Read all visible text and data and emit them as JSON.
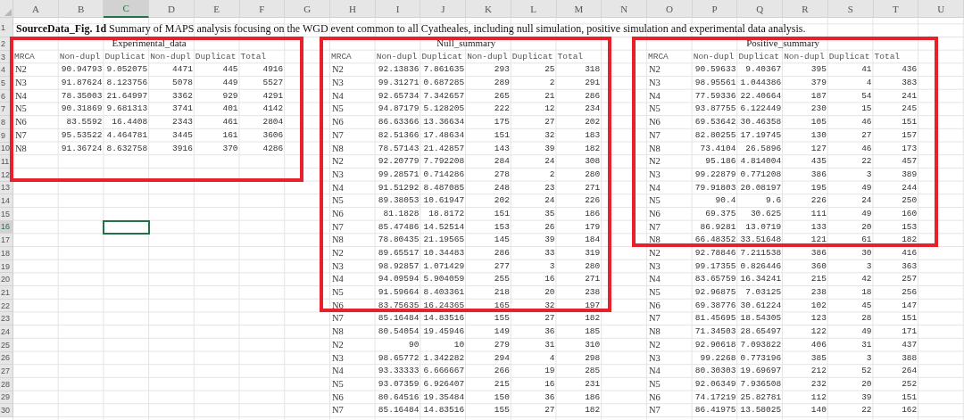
{
  "column_headers": [
    {
      "label": "A",
      "selected": false
    },
    {
      "label": "B",
      "selected": false
    },
    {
      "label": "C",
      "selected": true
    },
    {
      "label": "D",
      "selected": false
    },
    {
      "label": "E",
      "selected": false
    },
    {
      "label": "F",
      "selected": false
    },
    {
      "label": "G",
      "selected": false
    },
    {
      "label": "H",
      "selected": false
    },
    {
      "label": "I",
      "selected": false
    },
    {
      "label": "J",
      "selected": false
    },
    {
      "label": "K",
      "selected": false
    },
    {
      "label": "L",
      "selected": false
    },
    {
      "label": "M",
      "selected": false
    },
    {
      "label": "N",
      "selected": false
    },
    {
      "label": "O",
      "selected": false
    },
    {
      "label": "P",
      "selected": false
    },
    {
      "label": "Q",
      "selected": false
    },
    {
      "label": "R",
      "selected": false
    },
    {
      "label": "S",
      "selected": false
    },
    {
      "label": "T",
      "selected": false
    },
    {
      "label": "U",
      "selected": false
    }
  ],
  "row_headers": [
    {
      "label": "1",
      "selected": false
    },
    {
      "label": "2",
      "selected": false
    },
    {
      "label": "3",
      "selected": false
    },
    {
      "label": "4",
      "selected": false
    },
    {
      "label": "5",
      "selected": false
    },
    {
      "label": "6",
      "selected": false
    },
    {
      "label": "7",
      "selected": false
    },
    {
      "label": "8",
      "selected": false
    },
    {
      "label": "9",
      "selected": false
    },
    {
      "label": "10",
      "selected": false
    },
    {
      "label": "11",
      "selected": false
    },
    {
      "label": "12",
      "selected": false
    },
    {
      "label": "13",
      "selected": false
    },
    {
      "label": "14",
      "selected": false
    },
    {
      "label": "15",
      "selected": false
    },
    {
      "label": "16",
      "selected": true
    },
    {
      "label": "17",
      "selected": false
    },
    {
      "label": "18",
      "selected": false
    },
    {
      "label": "19",
      "selected": false
    },
    {
      "label": "20",
      "selected": false
    },
    {
      "label": "21",
      "selected": false
    },
    {
      "label": "22",
      "selected": false
    },
    {
      "label": "23",
      "selected": false
    },
    {
      "label": "24",
      "selected": false
    },
    {
      "label": "25",
      "selected": false
    },
    {
      "label": "26",
      "selected": false
    },
    {
      "label": "27",
      "selected": false
    },
    {
      "label": "28",
      "selected": false
    },
    {
      "label": "29",
      "selected": false
    },
    {
      "label": "30",
      "selected": false
    }
  ],
  "title": "**SourceData_Fig. 1d** Summary of MAPS analysis focusing on the WGD event common to all Cyatheales, including null simulation, positive simulation and experimental data analysis.",
  "tables": [
    {
      "title": "Experimental_data",
      "highlighted": true,
      "columns": [
        "MRCA",
        "Non-dupl",
        "Duplicat",
        "Non-dupl",
        "Duplicat",
        "Total"
      ],
      "rows": [
        [
          "N2",
          "90.94793",
          "9.052075",
          "4471",
          "445",
          "4916"
        ],
        [
          "N3",
          "91.87624",
          "8.123756",
          "5078",
          "449",
          "5527"
        ],
        [
          "N4",
          "78.35003",
          "21.64997",
          "3362",
          "929",
          "4291"
        ],
        [
          "N5",
          "90.31869",
          "9.681313",
          "3741",
          "401",
          "4142"
        ],
        [
          "N6",
          "83.5592",
          "16.4408",
          "2343",
          "461",
          "2804"
        ],
        [
          "N7",
          "95.53522",
          "4.464781",
          "3445",
          "161",
          "3606"
        ],
        [
          "N8",
          "91.36724",
          "8.632758",
          "3916",
          "370",
          "4286"
        ]
      ]
    },
    {
      "title": "Null_summary",
      "highlighted": true,
      "columns": [
        "MRCA",
        "Non-dupl",
        "Duplicat",
        "Non-dupl",
        "Duplicat",
        "Total"
      ],
      "rows": [
        [
          "N2",
          "92.13836",
          "7.861635",
          "293",
          "25",
          "318"
        ],
        [
          "N3",
          "99.31271",
          "0.687285",
          "289",
          "2",
          "291"
        ],
        [
          "N4",
          "92.65734",
          "7.342657",
          "265",
          "21",
          "286"
        ],
        [
          "N5",
          "94.87179",
          "5.128205",
          "222",
          "12",
          "234"
        ],
        [
          "N6",
          "86.63366",
          "13.36634",
          "175",
          "27",
          "202"
        ],
        [
          "N7",
          "82.51366",
          "17.48634",
          "151",
          "32",
          "183"
        ],
        [
          "N8",
          "78.57143",
          "21.42857",
          "143",
          "39",
          "182"
        ],
        [
          "N2",
          "92.20779",
          "7.792208",
          "284",
          "24",
          "308"
        ],
        [
          "N3",
          "99.28571",
          "0.714286",
          "278",
          "2",
          "280"
        ],
        [
          "N4",
          "91.51292",
          "8.487085",
          "248",
          "23",
          "271"
        ],
        [
          "N5",
          "89.38053",
          "10.61947",
          "202",
          "24",
          "226"
        ],
        [
          "N6",
          "81.1828",
          "18.8172",
          "151",
          "35",
          "186"
        ],
        [
          "N7",
          "85.47486",
          "14.52514",
          "153",
          "26",
          "179"
        ],
        [
          "N8",
          "78.80435",
          "21.19565",
          "145",
          "39",
          "184"
        ],
        [
          "N2",
          "89.65517",
          "10.34483",
          "286",
          "33",
          "319"
        ],
        [
          "N3",
          "98.92857",
          "1.071429",
          "277",
          "3",
          "280"
        ],
        [
          "N4",
          "94.09594",
          "5.904059",
          "255",
          "16",
          "271"
        ],
        [
          "N5",
          "91.59664",
          "8.403361",
          "218",
          "20",
          "238"
        ],
        [
          "N6",
          "83.75635",
          "16.24365",
          "165",
          "32",
          "197"
        ],
        [
          "N7",
          "85.16484",
          "14.83516",
          "155",
          "27",
          "182"
        ],
        [
          "N8",
          "80.54054",
          "19.45946",
          "149",
          "36",
          "185"
        ],
        [
          "N2",
          "90",
          "10",
          "279",
          "31",
          "310"
        ],
        [
          "N3",
          "98.65772",
          "1.342282",
          "294",
          "4",
          "298"
        ],
        [
          "N4",
          "93.33333",
          "6.666667",
          "266",
          "19",
          "285"
        ],
        [
          "N5",
          "93.07359",
          "6.926407",
          "215",
          "16",
          "231"
        ],
        [
          "N6",
          "80.64516",
          "19.35484",
          "150",
          "36",
          "186"
        ],
        [
          "N7",
          "85.16484",
          "14.83516",
          "155",
          "27",
          "182"
        ]
      ]
    },
    {
      "title": "Positive_summary",
      "highlighted": true,
      "columns": [
        "MRCA",
        "Non-dupl",
        "Duplicat",
        "Non-dupl",
        "Duplicat",
        "Total"
      ],
      "rows": [
        [
          "N2",
          "90.59633",
          "9.40367",
          "395",
          "41",
          "436"
        ],
        [
          "N3",
          "98.95561",
          "1.044386",
          "379",
          "4",
          "383"
        ],
        [
          "N4",
          "77.59336",
          "22.40664",
          "187",
          "54",
          "241"
        ],
        [
          "N5",
          "93.87755",
          "6.122449",
          "230",
          "15",
          "245"
        ],
        [
          "N6",
          "69.53642",
          "30.46358",
          "105",
          "46",
          "151"
        ],
        [
          "N7",
          "82.80255",
          "17.19745",
          "130",
          "27",
          "157"
        ],
        [
          "N8",
          "73.4104",
          "26.5896",
          "127",
          "46",
          "173"
        ],
        [
          "N2",
          "95.186",
          "4.814004",
          "435",
          "22",
          "457"
        ],
        [
          "N3",
          "99.22879",
          "0.771208",
          "386",
          "3",
          "389"
        ],
        [
          "N4",
          "79.91803",
          "20.08197",
          "195",
          "49",
          "244"
        ],
        [
          "N5",
          "90.4",
          "9.6",
          "226",
          "24",
          "250"
        ],
        [
          "N6",
          "69.375",
          "30.625",
          "111",
          "49",
          "160"
        ],
        [
          "N7",
          "86.9281",
          "13.0719",
          "133",
          "20",
          "153"
        ],
        [
          "N8",
          "66.48352",
          "33.51648",
          "121",
          "61",
          "182"
        ],
        [
          "N2",
          "92.78846",
          "7.211538",
          "386",
          "30",
          "416"
        ],
        [
          "N3",
          "99.17355",
          "0.826446",
          "360",
          "3",
          "363"
        ],
        [
          "N4",
          "83.65759",
          "16.34241",
          "215",
          "42",
          "257"
        ],
        [
          "N5",
          "92.96875",
          "7.03125",
          "238",
          "18",
          "256"
        ],
        [
          "N6",
          "69.38776",
          "30.61224",
          "102",
          "45",
          "147"
        ],
        [
          "N7",
          "81.45695",
          "18.54305",
          "123",
          "28",
          "151"
        ],
        [
          "N8",
          "71.34503",
          "28.65497",
          "122",
          "49",
          "171"
        ],
        [
          "N2",
          "92.90618",
          "7.093822",
          "406",
          "31",
          "437"
        ],
        [
          "N3",
          "99.2268",
          "0.773196",
          "385",
          "3",
          "388"
        ],
        [
          "N4",
          "80.30303",
          "19.69697",
          "212",
          "52",
          "264"
        ],
        [
          "N5",
          "92.06349",
          "7.936508",
          "232",
          "20",
          "252"
        ],
        [
          "N6",
          "74.17219",
          "25.82781",
          "112",
          "39",
          "151"
        ],
        [
          "N7",
          "86.41975",
          "13.58025",
          "140",
          "22",
          "162"
        ]
      ]
    }
  ]
}
